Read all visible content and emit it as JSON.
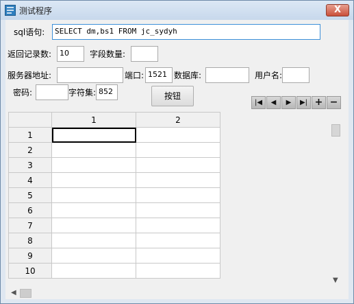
{
  "window": {
    "title": "测试程序",
    "close_label": "X"
  },
  "form": {
    "sql_label": "sql语句:",
    "sql_value": "SELECT dm,bs1 FROM jc_sydyh",
    "return_count_label": "返回记录数:",
    "return_count_value": "10",
    "field_count_label": "字段数量:",
    "field_count_value": "",
    "server_label": "服务器地址:",
    "server_value": "",
    "port_label": "端口:",
    "port_value": "1521",
    "db_label": "数据库:",
    "db_value": "",
    "user_label": "用户名:",
    "user_value": "",
    "password_label": "密码:",
    "password_value": "",
    "charset_label": "字符集:",
    "charset_value": "852",
    "button_label": "按钮"
  },
  "navigator": {
    "first": "|◀",
    "prev": "◀",
    "next": "▶",
    "last": "▶|",
    "add": "+",
    "delete": "−"
  },
  "grid": {
    "columns": [
      "1",
      "2"
    ],
    "rows": [
      "1",
      "2",
      "3",
      "4",
      "5",
      "6",
      "7",
      "8",
      "9",
      "10"
    ]
  }
}
